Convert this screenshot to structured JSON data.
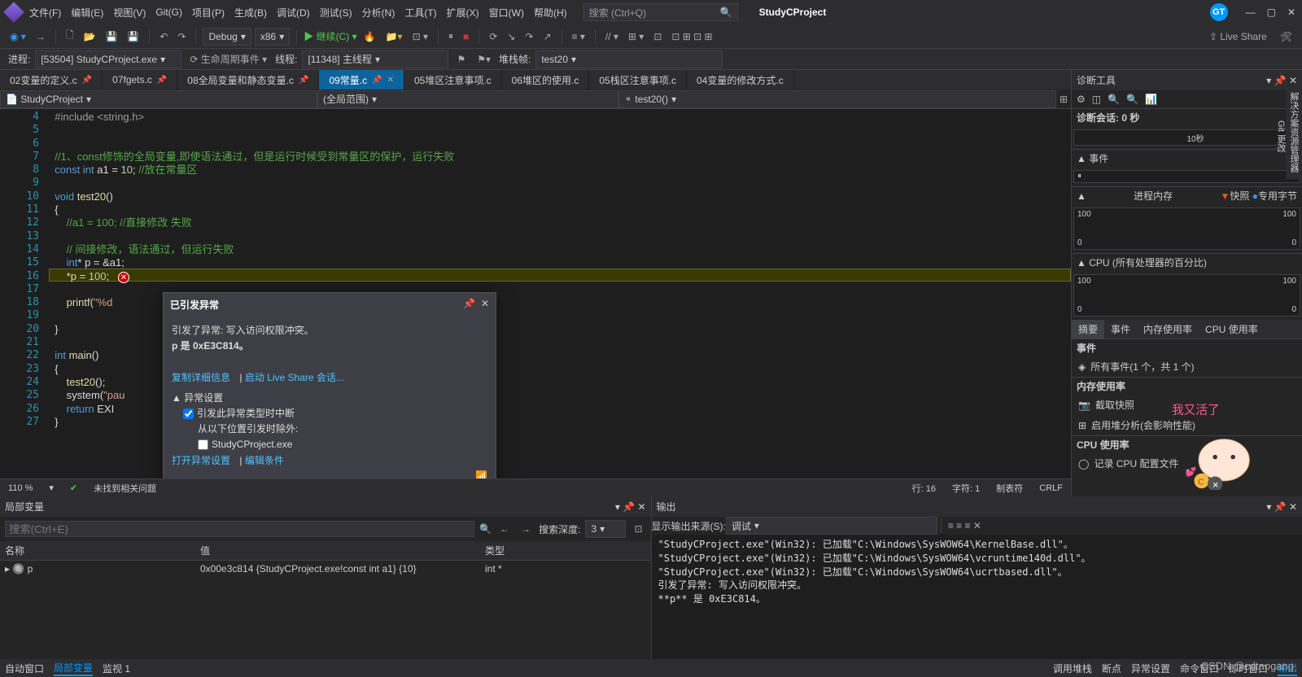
{
  "app": {
    "project_name": "StudyCProject",
    "search_placeholder": "搜索 (Ctrl+Q)",
    "user_badge": "GT"
  },
  "menu": [
    "文件(F)",
    "编辑(E)",
    "视图(V)",
    "Git(G)",
    "项目(P)",
    "生成(B)",
    "调试(D)",
    "测试(S)",
    "分析(N)",
    "工具(T)",
    "扩展(X)",
    "窗口(W)",
    "帮助(H)"
  ],
  "toolbar": {
    "config": "Debug",
    "platform": "x86",
    "continue": "继续(C)",
    "liveshare": "Live Share"
  },
  "debugbar": {
    "process_label": "进程:",
    "process": "[53504] StudyCProject.exe",
    "lifecycle": "生命周期事件",
    "thread_label": "线程:",
    "thread": "[11348] 主线程",
    "stackframe_label": "堆栈帧:",
    "stackframe": "test20"
  },
  "tabs": [
    {
      "label": "02变量的定义.c",
      "active": false,
      "pin": true
    },
    {
      "label": "07fgets.c",
      "active": false,
      "pin": true
    },
    {
      "label": "08全局变量和静态变量.c",
      "active": false,
      "pin": true
    },
    {
      "label": "09常量.c",
      "active": true,
      "pin": true
    },
    {
      "label": "05堆区注意事项.c",
      "active": false
    },
    {
      "label": "06堆区的使用.c",
      "active": false
    },
    {
      "label": "05栈区注意事项.c",
      "active": false
    },
    {
      "label": "04变量的修改方式.c",
      "active": false
    }
  ],
  "scopebar": {
    "scope": "StudyCProject",
    "region": "(全局范围)",
    "func": "test20()"
  },
  "code": {
    "lines": [
      {
        "n": 4,
        "h": "<span class='pp'>#include &lt;string.h&gt;</span>"
      },
      {
        "n": 5,
        "h": ""
      },
      {
        "n": 6,
        "h": ""
      },
      {
        "n": 7,
        "h": "<span class='cmt'>//1、const修饰的全局变量,即使语法通过，但是运行时候受到常量区的保护，运行失败</span>"
      },
      {
        "n": 8,
        "h": "<span class='kw'>const int</span> a1 = <span class='num'>10</span>; <span class='cmt'>//放在常量区</span>"
      },
      {
        "n": 9,
        "h": ""
      },
      {
        "n": 10,
        "h": "<span class='kw'>void</span> <span class='fn'>test20</span>()"
      },
      {
        "n": 11,
        "h": "{"
      },
      {
        "n": 12,
        "h": "    <span class='cmt'>//a1 = 100; //直接修改 失败</span>"
      },
      {
        "n": 13,
        "h": ""
      },
      {
        "n": 14,
        "h": "    <span class='cmt'>// 间接修改，语法通过，但运行失败</span>"
      },
      {
        "n": 15,
        "h": "    <span class='kw'>int</span>* p = &amp;a1;"
      },
      {
        "n": 16,
        "h": "    *p = <span class='num'>100</span>;   <span class='err-circle'>✕</span>",
        "current": true
      },
      {
        "n": 17,
        "h": ""
      },
      {
        "n": 18,
        "h": "    <span class='fn'>printf</span>(<span class='str'>\"%d</span>"
      },
      {
        "n": 19,
        "h": ""
      },
      {
        "n": 20,
        "h": "}"
      },
      {
        "n": 21,
        "h": ""
      },
      {
        "n": 22,
        "h": "<span class='kw'>int</span> <span class='fn'>main</span>()"
      },
      {
        "n": 23,
        "h": "{"
      },
      {
        "n": 24,
        "h": "    <span class='fn'>test20</span>();"
      },
      {
        "n": 25,
        "h": "    system(<span class='str'>\"pau</span>"
      },
      {
        "n": 26,
        "h": "    <span class='kw'>return</span> EXI"
      },
      {
        "n": 27,
        "h": "}"
      }
    ]
  },
  "exception": {
    "title": "已引发异常",
    "msg1": "引发了异常: 写入访问权限冲突。",
    "msg2": "p 是 0xE3C814。",
    "copy": "复制详细信息",
    "ls": "启动 Live Share 会话...",
    "settings": "异常设置",
    "opt1": "引发此异常类型时中断",
    "opt2_pre": "从以下位置引发时除外:",
    "opt2_item": "StudyCProject.exe",
    "link1": "打开异常设置",
    "link2": "编辑条件"
  },
  "editor_status": {
    "zoom": "110 %",
    "issues": "未找到相关问题",
    "ln": "行: 16",
    "col": "字符: 1",
    "tabs": "制表符",
    "crlf": "CRLF"
  },
  "diag": {
    "title": "诊断工具",
    "session": "诊断会话: 0 秒",
    "t10": "10秒",
    "events": "事件",
    "procmem": "进程内存",
    "snapshot": "快照",
    "private": "专用字节",
    "cpu": "CPU (所有处理器的百分比)",
    "v100": "100",
    "v0": "0",
    "tabs": [
      "摘要",
      "事件",
      "内存使用率",
      "CPU 使用率"
    ],
    "evt_h": "事件",
    "evt_all": "所有事件(1 个，共 1 个)",
    "mem_h": "内存使用率",
    "mem_snap": "截取快照",
    "mem_heap": "启用堆分析(会影响性能)",
    "cpu_h": "CPU 使用率",
    "cpu_rec": "记录 CPU 配置文件"
  },
  "sidebar_vert": {
    "a": "解决方案资源管理器",
    "b": "Git 更改"
  },
  "locals": {
    "title": "局部变量",
    "search_ph": "搜索(Ctrl+E)",
    "depth_label": "搜索深度:",
    "depth": "3",
    "cols": {
      "name": "名称",
      "value": "值",
      "type": "类型"
    },
    "rows": [
      {
        "name": "p",
        "value": "0x00e3c814 {StudyCProject.exe!const int a1} {10}",
        "type": "int *"
      }
    ]
  },
  "output": {
    "title": "输出",
    "src_label": "显示输出来源(S):",
    "src": "调试",
    "lines": [
      "\"StudyCProject.exe\"(Win32): 已加载\"C:\\Windows\\SysWOW64\\KernelBase.dll\"。",
      "\"StudyCProject.exe\"(Win32): 已加载\"C:\\Windows\\SysWOW64\\vcruntime140d.dll\"。",
      "\"StudyCProject.exe\"(Win32): 已加载\"C:\\Windows\\SysWOW64\\ucrtbased.dll\"。",
      "引发了异常: 写入访问权限冲突。",
      "**p** 是 0xE3C814。"
    ]
  },
  "bottom_tabs_left": [
    {
      "l": "自动窗口"
    },
    {
      "l": "局部变量",
      "act": true
    },
    {
      "l": "监视 1"
    }
  ],
  "bottom_tabs_right": [
    {
      "l": "调用堆栈"
    },
    {
      "l": "断点"
    },
    {
      "l": "异常设置"
    },
    {
      "l": "命令窗口"
    },
    {
      "l": "即时窗口"
    },
    {
      "l": "输出",
      "act": true
    }
  ],
  "watermark": "CSDN @cdtaogang"
}
